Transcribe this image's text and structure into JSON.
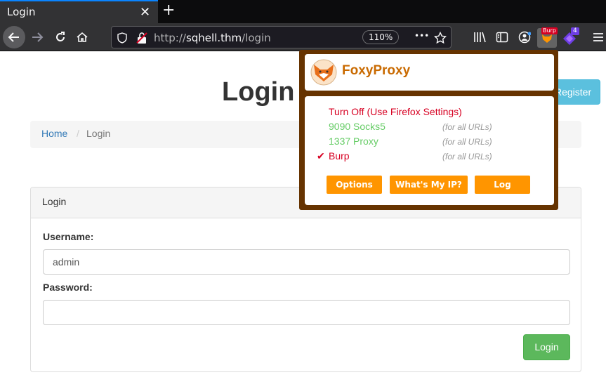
{
  "browser": {
    "tab_title": "Login",
    "tab_close": "✕",
    "new_tab": "+",
    "url_scheme": "http://",
    "url_host": "sqhell.thm",
    "url_path": "/login",
    "zoom": "110%",
    "page_actions": "•••",
    "burp_badge": "Burp",
    "ext_badge_count": "4"
  },
  "page": {
    "title": "Login",
    "register_label": "Register",
    "breadcrumb": {
      "home": "Home",
      "separator": "/",
      "current": "Login"
    },
    "panel_title": "Login",
    "username_label": "Username:",
    "username_value": "admin",
    "password_label": "Password:",
    "password_value": "",
    "login_button": "Login"
  },
  "foxyproxy": {
    "title": "FoxyProxy",
    "items": [
      {
        "label": "Turn Off (Use Firefox Settings)",
        "scope": "",
        "selected": "",
        "color": "#d70022"
      },
      {
        "label": "9090 Socks5",
        "scope": "(for all URLs)",
        "selected": "",
        "color": "#66cc66"
      },
      {
        "label": "1337 Proxy",
        "scope": "(for all URLs)",
        "selected": "",
        "color": "#66cc66"
      },
      {
        "label": "Burp",
        "scope": "(for all URLs)",
        "selected": "✔",
        "color": "#d70022"
      }
    ],
    "buttons": {
      "options": "Options",
      "whats_my_ip": "What's My IP?",
      "log": "Log"
    }
  },
  "colors": {
    "tab_accent": "#0a84ff",
    "popup_border": "#663300",
    "popup_button": "#ff9500",
    "brand": "#c96a00",
    "register": "#5bc0de",
    "login": "#5cb85c",
    "link": "#337ab7"
  }
}
